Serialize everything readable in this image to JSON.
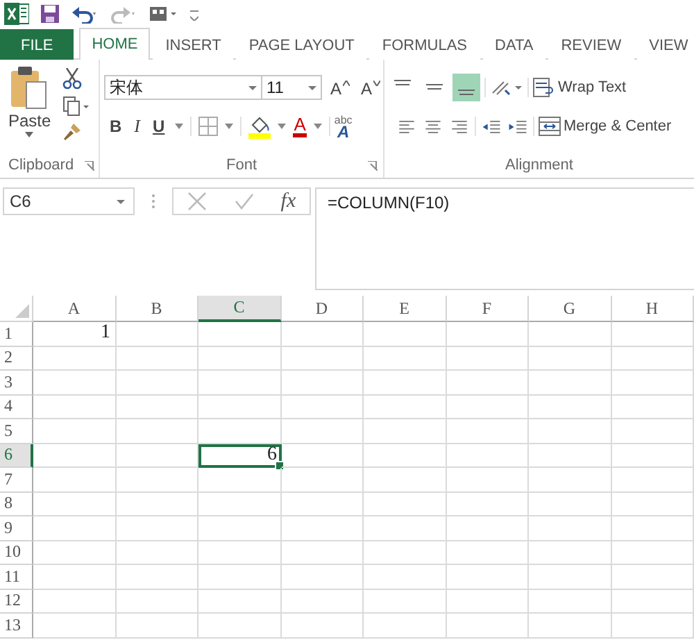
{
  "tabs": [
    {
      "label": "FILE",
      "kind": "file",
      "selected": false
    },
    {
      "label": "HOME",
      "kind": "tab",
      "selected": true
    },
    {
      "label": "INSERT",
      "kind": "tab",
      "selected": false
    },
    {
      "label": "PAGE LAYOUT",
      "kind": "tab",
      "selected": false
    },
    {
      "label": "FORMULAS",
      "kind": "tab",
      "selected": false
    },
    {
      "label": "DATA",
      "kind": "tab",
      "selected": false
    },
    {
      "label": "REVIEW",
      "kind": "tab",
      "selected": false
    },
    {
      "label": "VIEW",
      "kind": "tab",
      "selected": false
    }
  ],
  "clipboard": {
    "paste_label": "Paste",
    "group_label": "Clipboard"
  },
  "font": {
    "name": "宋体",
    "size": "11",
    "grow": "A",
    "shrink": "A",
    "bold": "B",
    "italic": "I",
    "underline": "U",
    "phonetic_top": "abc",
    "phonetic_bottom": "A",
    "font_color": "A",
    "group_label": "Font"
  },
  "alignment": {
    "vertical": [
      {
        "selected": false
      },
      {
        "selected": false
      },
      {
        "selected": true
      }
    ],
    "wrap_text": "Wrap Text",
    "merge_center": "Merge & Center",
    "group_label": "Alignment"
  },
  "formula_bar": {
    "name_box": "C6",
    "fx": "fx",
    "formula": "=COLUMN(F10)"
  },
  "sheet": {
    "columns": [
      {
        "label": "A",
        "selected": false
      },
      {
        "label": "B",
        "selected": false
      },
      {
        "label": "C",
        "selected": true
      },
      {
        "label": "D",
        "selected": false
      },
      {
        "label": "E",
        "selected": false
      },
      {
        "label": "F",
        "selected": false
      },
      {
        "label": "G",
        "selected": false
      },
      {
        "label": "H",
        "selected": false
      }
    ],
    "rows": [
      {
        "label": "1",
        "selected": false,
        "cells": [
          "1"
        ]
      },
      {
        "label": "2",
        "selected": false
      },
      {
        "label": "3",
        "selected": false
      },
      {
        "label": "4",
        "selected": false
      },
      {
        "label": "5",
        "selected": false
      },
      {
        "label": "6",
        "selected": true,
        "cells": [
          null,
          null,
          "6"
        ]
      },
      {
        "label": "7",
        "selected": false
      },
      {
        "label": "8",
        "selected": false
      },
      {
        "label": "9",
        "selected": false
      },
      {
        "label": "10",
        "selected": false
      },
      {
        "label": "11",
        "selected": false
      },
      {
        "label": "12",
        "selected": false
      },
      {
        "label": "13",
        "selected": false
      }
    ]
  }
}
